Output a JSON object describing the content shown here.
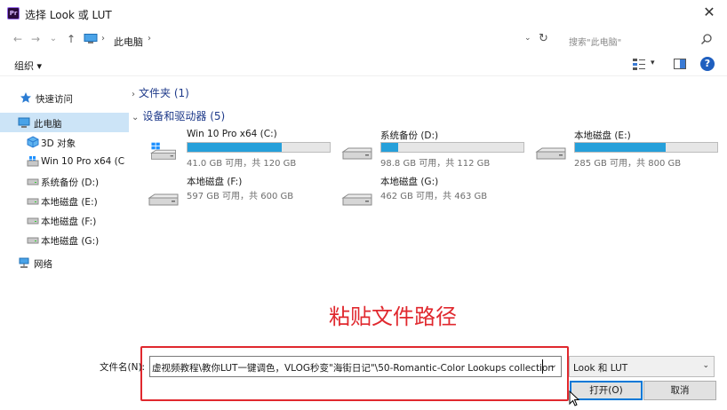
{
  "window": {
    "title": "选择 Look 或 LUT",
    "app_icon_text": "Pr",
    "close_glyph": "✕"
  },
  "nav": {
    "back_glyph": "←",
    "forward_glyph": "→",
    "recent_glyph": "⌄",
    "up_glyph": "↑",
    "breadcrumb": "此电脑",
    "search_placeholder": "搜索\"此电脑\""
  },
  "toolbar": {
    "organize_label": "组织 ▾"
  },
  "sidebar": {
    "items": [
      {
        "label": "快速访问",
        "icon": "star-icon"
      },
      {
        "label": "此电脑",
        "icon": "computer-icon"
      },
      {
        "label": "3D 对象",
        "icon": "3d-objects-icon"
      },
      {
        "label": "Win 10 Pro x64 (C",
        "icon": "windows-drive-icon"
      },
      {
        "label": "系统备份 (D:)",
        "icon": "drive-icon"
      },
      {
        "label": "本地磁盘 (E:)",
        "icon": "drive-icon"
      },
      {
        "label": "本地磁盘 (F:)",
        "icon": "drive-icon"
      },
      {
        "label": "本地磁盘 (G:)",
        "icon": "drive-icon"
      },
      {
        "label": "网络",
        "icon": "network-icon"
      }
    ]
  },
  "main": {
    "folders_header": "文件夹 (1)",
    "devices_header": "设备和驱动器 (5)",
    "drives": [
      {
        "name": "Win 10 Pro x64 (C:)",
        "size": "41.0 GB 可用，共 120 GB",
        "used_fraction": 0.66,
        "show_bar": true,
        "windows": true
      },
      {
        "name": "系统备份 (D:)",
        "size": "98.8 GB 可用，共 112 GB",
        "used_fraction": 0.12,
        "show_bar": true,
        "windows": false
      },
      {
        "name": "本地磁盘 (E:)",
        "size": "285 GB 可用，共 800 GB",
        "used_fraction": 0.64,
        "show_bar": true,
        "windows": false
      },
      {
        "name": "本地磁盘 (F:)",
        "size": "597 GB 可用，共 600 GB",
        "used_fraction": 0.005,
        "show_bar": false,
        "windows": false
      },
      {
        "name": "本地磁盘 (G:)",
        "size": "462 GB 可用，共 463 GB",
        "used_fraction": 0.002,
        "show_bar": false,
        "windows": false
      }
    ]
  },
  "annotation": {
    "text": "粘贴文件路径",
    "color": "#e0282e"
  },
  "footer": {
    "filename_label": "文件名(N):",
    "filename_value": "虚视频教程\\教你LUT一键调色，VLOG秒变\"海街日记\"\\50-Romantic-Color Lookups collection",
    "filetype_value": "Look 和 LUT",
    "open_label": "打开(O)",
    "cancel_label": "取消"
  },
  "colors": {
    "accent": "#0078d7",
    "drive_fill": "#26a0da",
    "selected_bg": "#cce4f7"
  }
}
